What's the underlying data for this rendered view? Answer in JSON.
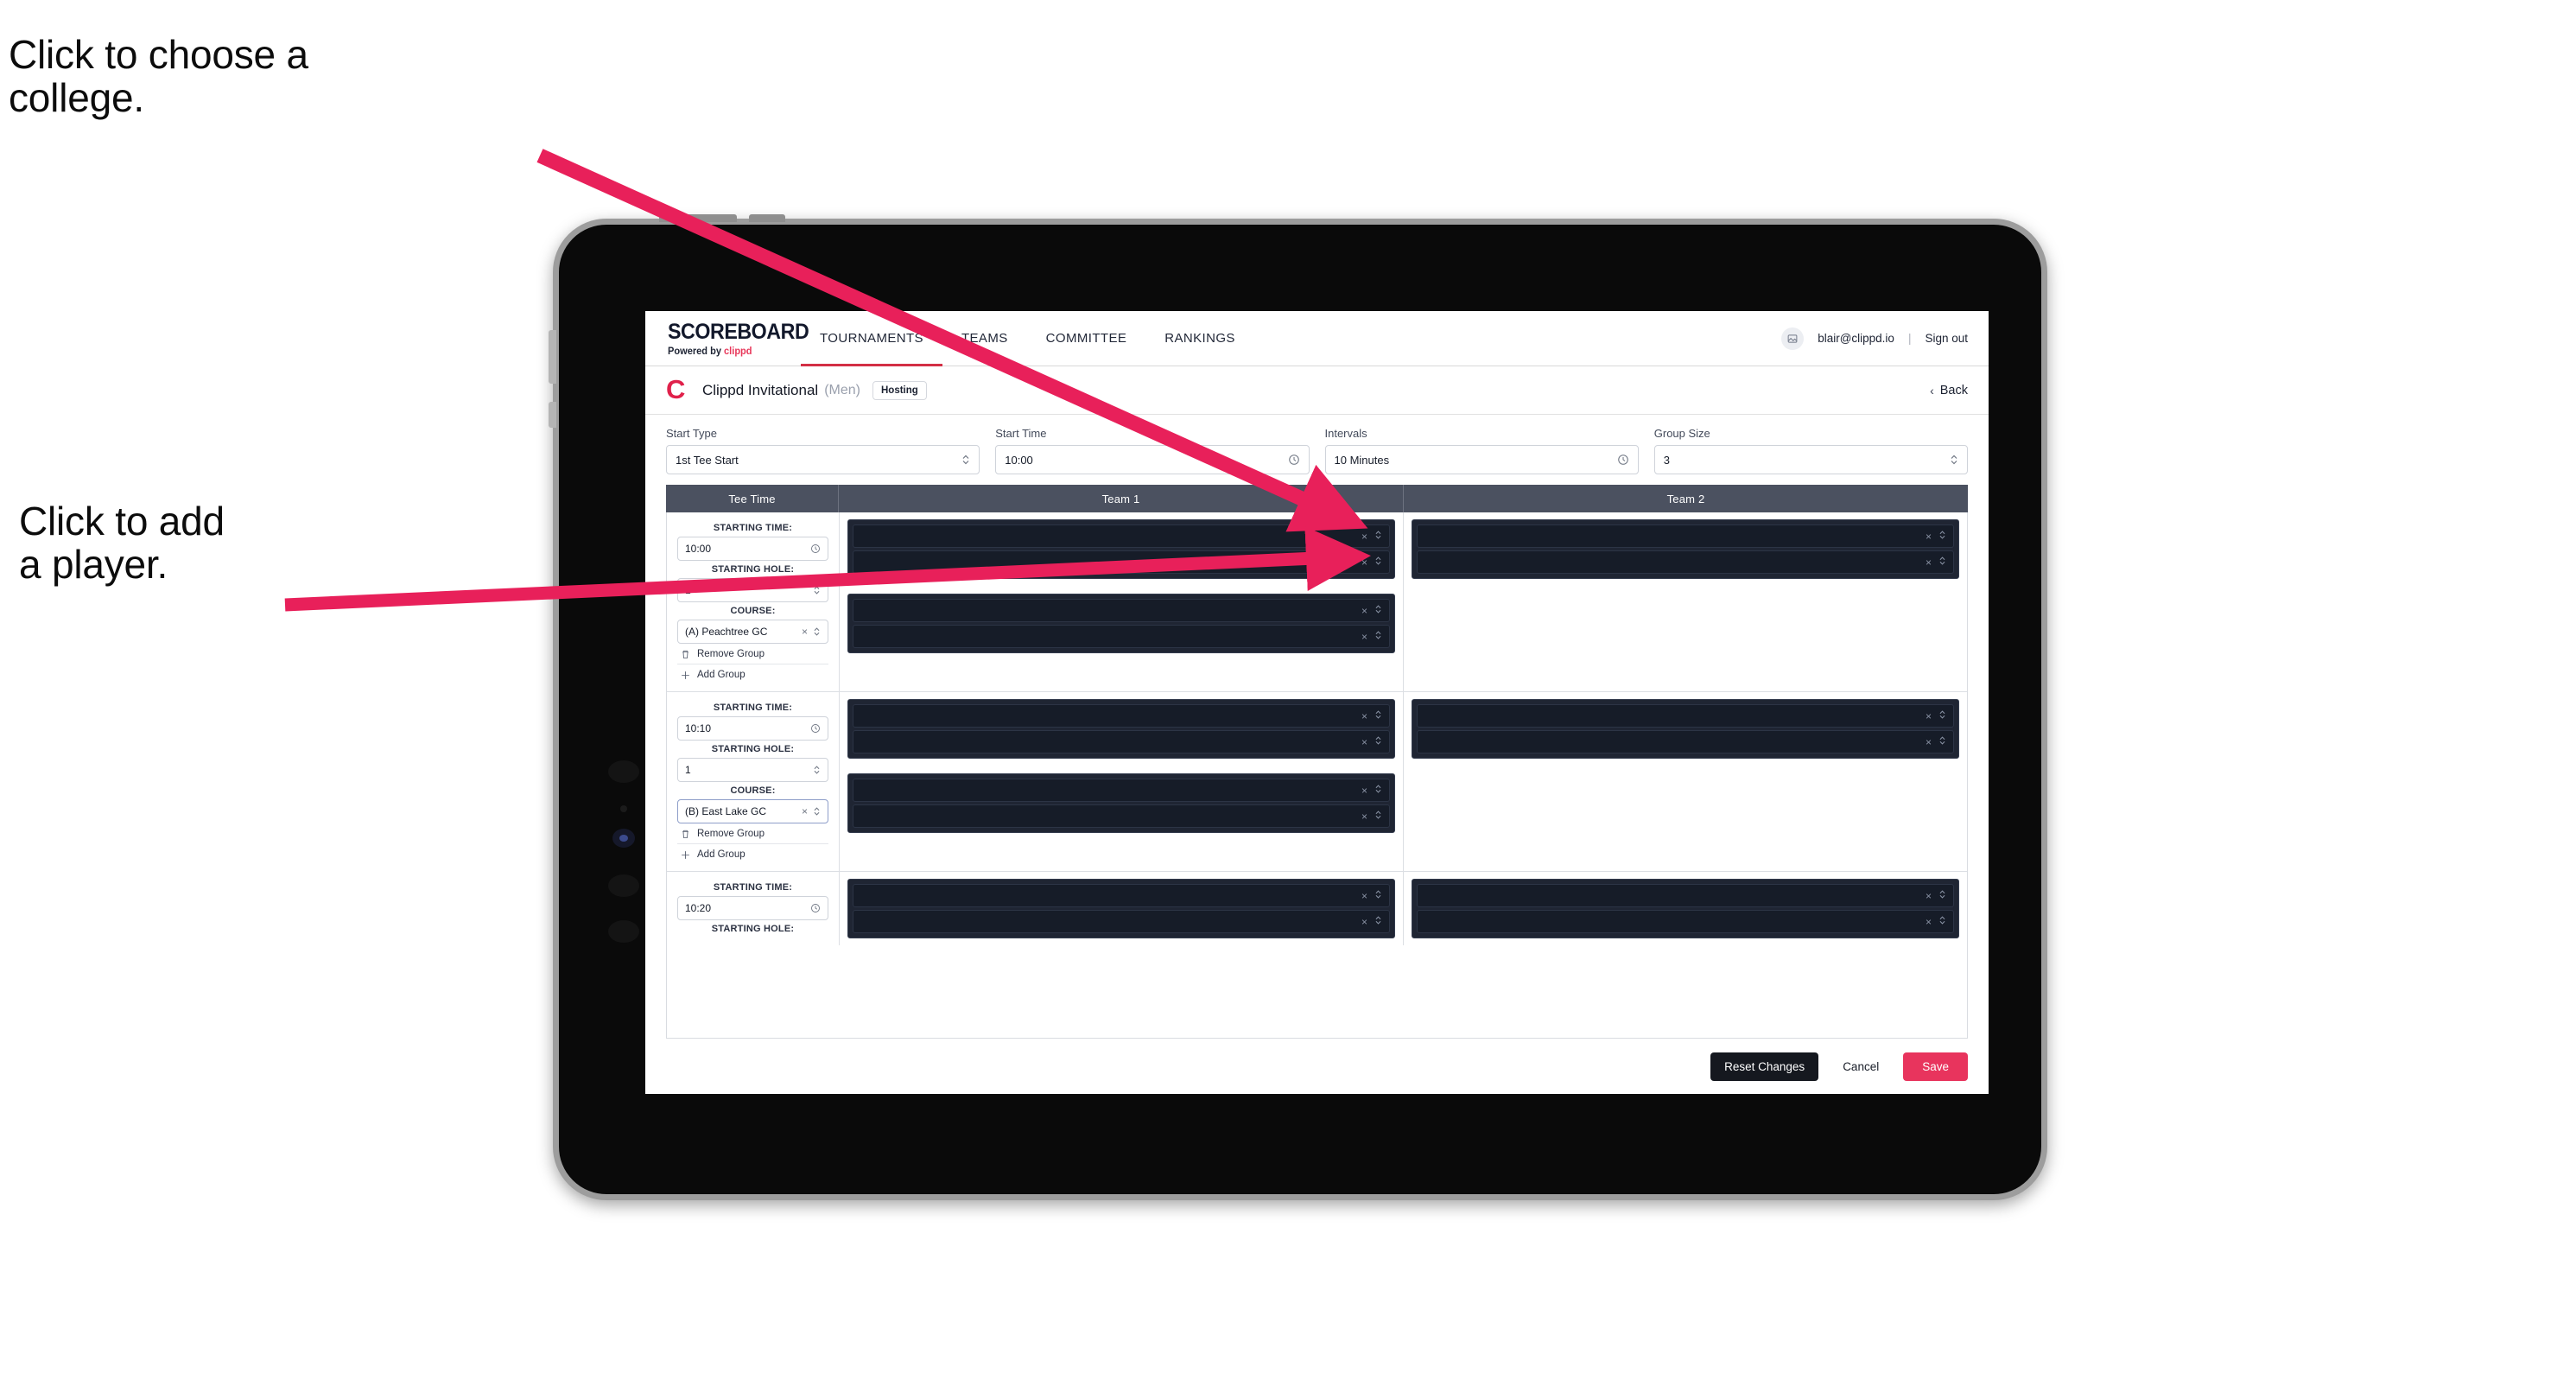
{
  "annotations": {
    "college": "Click to choose a\ncollege.",
    "player": "Click to add\na player.",
    "arrow_color": "#e8205a"
  },
  "nav": {
    "logo": "SCOREBOARD",
    "logo_sub_prefix": "Powered by ",
    "logo_sub_brand": "clippd",
    "tabs": [
      {
        "label": "TOURNAMENTS",
        "active": true
      },
      {
        "label": "TEAMS",
        "active": false
      },
      {
        "label": "COMMITTEE",
        "active": false
      },
      {
        "label": "RANKINGS",
        "active": false
      }
    ],
    "avatar_icon": "user-image-icon",
    "email": "blair@clippd.io",
    "separator": "|",
    "sign_out": "Sign out"
  },
  "tournament": {
    "logo_letter": "C",
    "name": "Clippd Invitational",
    "gender": "(Men)",
    "badge": "Hosting",
    "back_chevron": "‹",
    "back_label": "Back"
  },
  "controls": [
    {
      "label": "Start Type",
      "value": "1st Tee Start",
      "icon": "stepper-icon"
    },
    {
      "label": "Start Time",
      "value": "10:00",
      "icon": "clock-icon"
    },
    {
      "label": "Intervals",
      "value": "10 Minutes",
      "icon": "clock-icon"
    },
    {
      "label": "Group Size",
      "value": "3",
      "icon": "stepper-icon"
    }
  ],
  "table": {
    "headers": [
      "Tee Time",
      "Team 1",
      "Team 2"
    ],
    "labels": {
      "starting_time": "STARTING TIME:",
      "starting_hole": "STARTING HOLE:",
      "course": "COURSE:",
      "remove_group": "Remove Group",
      "add_group": "Add Group",
      "clear_icon": "×",
      "stepper_icon": "stepper-icon",
      "clock_icon": "clock-icon",
      "trash_icon": "trash-icon",
      "plus_icon": "+"
    },
    "groups": [
      {
        "starting_time": "10:00",
        "starting_hole": "1",
        "course": "(A) Peachtree GC",
        "course_focused": false,
        "team1_blocks": [
          {
            "rows": [
              "",
              ""
            ]
          },
          {
            "rows": [
              "",
              ""
            ]
          }
        ],
        "team2_blocks": [
          {
            "rows": [
              "",
              ""
            ]
          }
        ]
      },
      {
        "starting_time": "10:10",
        "starting_hole": "1",
        "course": "(B) East Lake GC",
        "course_focused": true,
        "team1_blocks": [
          {
            "rows": [
              "",
              ""
            ]
          },
          {
            "rows": [
              "",
              ""
            ]
          }
        ],
        "team2_blocks": [
          {
            "rows": [
              "",
              ""
            ]
          }
        ]
      },
      {
        "starting_time": "10:20",
        "starting_hole": "",
        "course": "",
        "course_focused": false,
        "team1_blocks": [
          {
            "rows": [
              "",
              ""
            ]
          }
        ],
        "team2_blocks": [
          {
            "rows": [
              "",
              ""
            ]
          }
        ]
      }
    ]
  },
  "footer": {
    "reset": "Reset Changes",
    "cancel": "Cancel",
    "save": "Save",
    "save_color": "#e8345d"
  }
}
